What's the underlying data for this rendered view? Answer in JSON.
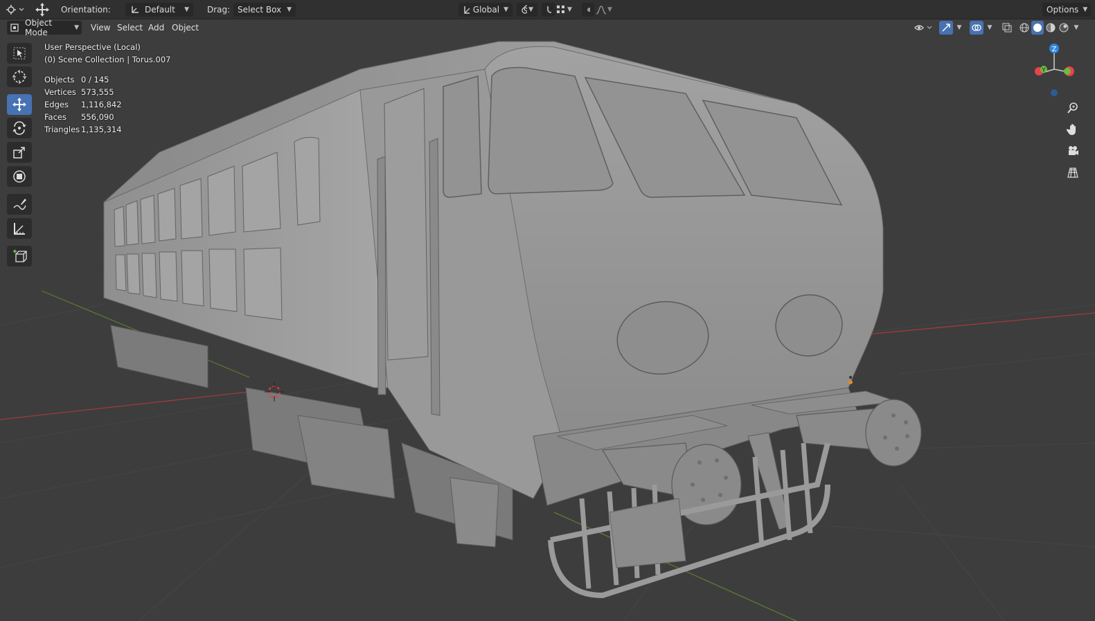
{
  "header": {
    "orientation_label": "Orientation:",
    "orientation_value": "Default",
    "drag_label": "Drag:",
    "drag_value": "Select Box",
    "transform_orientation": "Global",
    "options_label": "Options"
  },
  "menubar": {
    "mode": "Object Mode",
    "view": "View",
    "select": "Select",
    "add": "Add",
    "object": "Object"
  },
  "viewport": {
    "perspective": "User Perspective (Local)",
    "collection": "(0) Scene Collection | Torus.007"
  },
  "stats": [
    {
      "label": "Objects",
      "value": "0 / 145"
    },
    {
      "label": "Vertices",
      "value": "573,555"
    },
    {
      "label": "Edges",
      "value": "1,116,842"
    },
    {
      "label": "Faces",
      "value": "556,090"
    },
    {
      "label": "Triangles",
      "value": "1,135,314"
    }
  ],
  "gizmo": {
    "z": "Z",
    "y": "Y",
    "x": "X"
  },
  "tools": [
    "select-box-icon",
    "cursor-icon",
    "move-icon",
    "rotate-icon",
    "scale-icon",
    "transform-icon",
    "annotate-icon",
    "measure-icon",
    "add-cube-icon"
  ],
  "colors": {
    "active_tool": "#4772b3",
    "x_axis": "#e8424d",
    "y_axis": "#6cbd3d",
    "z_axis": "#2f86e0"
  }
}
